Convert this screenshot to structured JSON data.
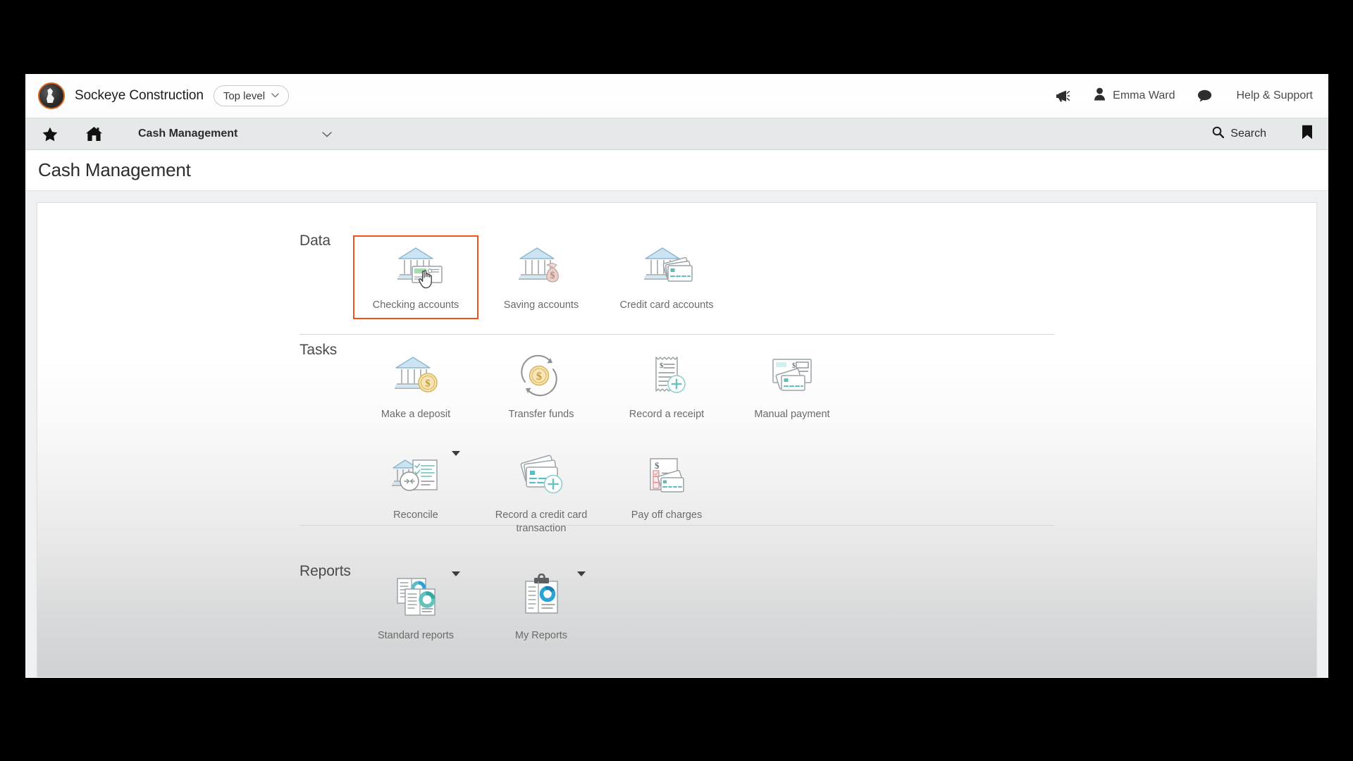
{
  "brand": {
    "logo_icon": "orca-logo-icon",
    "company": "Sockeye Construction",
    "level_label": "Top level",
    "level_caret": "⌄",
    "megaphone_icon": "megaphone-icon",
    "user_icon": "user-icon",
    "user_name": "Emma Ward",
    "chat_icon": "chat-bubble-icon",
    "help_label": "Help & Support"
  },
  "nav": {
    "star_icon": "star-icon",
    "home_icon": "home-icon",
    "module_label": "Cash Management",
    "module_caret": "⌄",
    "search_icon": "search-icon",
    "search_label": "Search",
    "bookmark_icon": "bookmark-icon"
  },
  "page": {
    "title": "Cash Management"
  },
  "sections": [
    {
      "label": "Data",
      "rows": [
        [
          {
            "label": "Checking accounts",
            "icon": "bank-check-icon",
            "highlighted": true,
            "caret": false
          },
          {
            "label": "Saving accounts",
            "icon": "bank-moneybag-icon",
            "highlighted": false,
            "caret": false
          },
          {
            "label": "Credit card accounts",
            "icon": "bank-creditcard-icon",
            "highlighted": false,
            "caret": false
          }
        ]
      ]
    },
    {
      "label": "Tasks",
      "rows": [
        [
          {
            "label": "Make a deposit",
            "icon": "bank-coin-icon",
            "highlighted": false,
            "caret": false
          },
          {
            "label": "Transfer funds",
            "icon": "transfer-coin-icon",
            "highlighted": false,
            "caret": false
          },
          {
            "label": "Record a receipt",
            "icon": "receipt-plus-icon",
            "highlighted": false,
            "caret": false
          },
          {
            "label": "Manual payment",
            "icon": "check-card-icon",
            "highlighted": false,
            "caret": false
          }
        ],
        [
          {
            "label": "Reconcile",
            "icon": "reconcile-icon",
            "highlighted": false,
            "caret": true
          },
          {
            "label": "Record a credit card transaction",
            "icon": "cards-plus-icon",
            "highlighted": false,
            "caret": false
          },
          {
            "label": "Pay off charges",
            "icon": "checklist-card-icon",
            "highlighted": false,
            "caret": false
          }
        ]
      ]
    },
    {
      "label": "Reports",
      "rows": [
        [
          {
            "label": "Standard reports",
            "icon": "reports-icon",
            "highlighted": false,
            "caret": true
          },
          {
            "label": "My Reports",
            "icon": "clipboard-report-icon",
            "highlighted": false,
            "caret": true
          }
        ]
      ]
    }
  ],
  "colors": {
    "highlight": "#f2531b",
    "brand_ring": "#d4641e",
    "navbar_bg": "#e6e9ea",
    "icon_blue": "#b8d8ea",
    "icon_teal": "#5bbcc4",
    "icon_gold": "#f5dca0",
    "icon_pink": "#e8c9c4",
    "icon_gray": "#8d9294"
  },
  "cursor": {
    "icon": "pointing-hand-cursor"
  }
}
